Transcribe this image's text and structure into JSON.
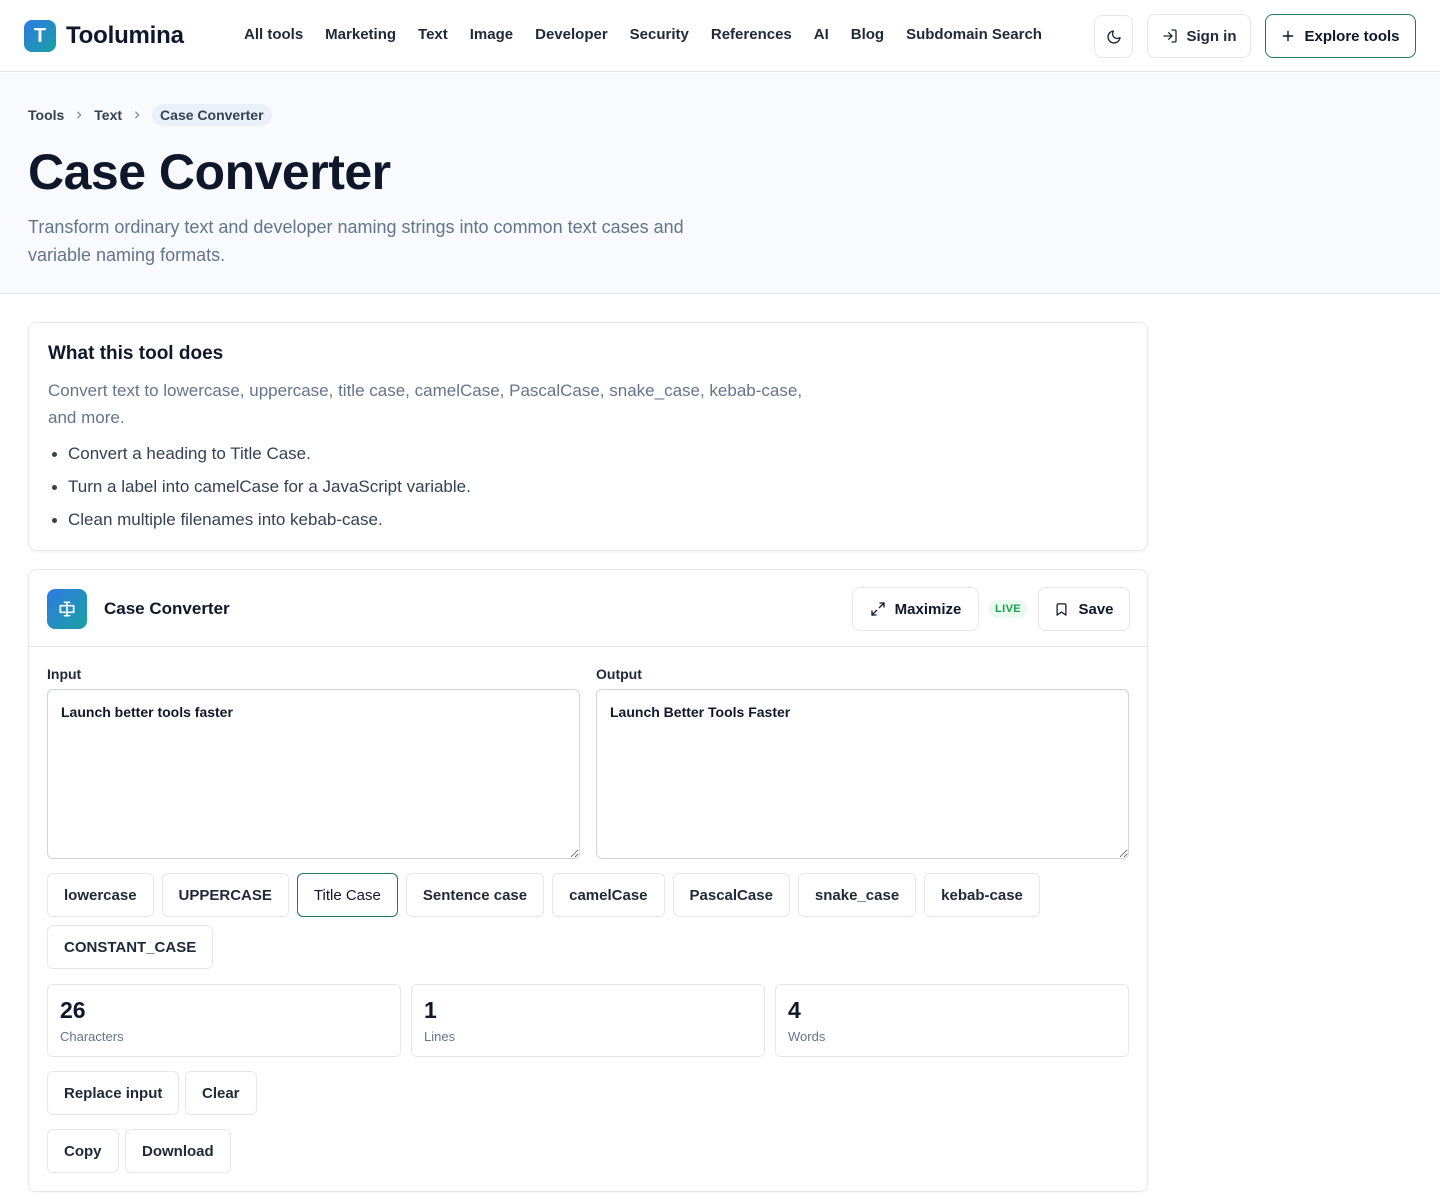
{
  "brand": {
    "logo_letter": "T",
    "name": "Toolumina"
  },
  "nav": [
    "All tools",
    "Marketing",
    "Text",
    "Image",
    "Developer",
    "Security",
    "References",
    "AI",
    "Blog",
    "Subdomain Search"
  ],
  "header": {
    "signin_label": "Sign in",
    "explore_label": "Explore tools"
  },
  "breadcrumb": {
    "root": "Tools",
    "category": "Text",
    "current": "Case Converter"
  },
  "hero": {
    "title": "Case Converter",
    "subtitle": "Transform ordinary text and developer naming strings into common text cases and variable naming formats."
  },
  "info": {
    "title": "What this tool does",
    "description": "Convert text to lowercase, uppercase, title case, camelCase, PascalCase, snake_case, kebab-case, and more.",
    "examples": [
      "Convert a heading to Title Case.",
      "Turn a label into camelCase for a JavaScript variable.",
      "Clean multiple filenames into kebab-case."
    ]
  },
  "tool": {
    "name": "Case Converter",
    "maximize_label": "Maximize",
    "live_label": "LIVE",
    "save_label": "Save",
    "input_label": "Input",
    "output_label": "Output",
    "input_value": "Launch better tools faster",
    "output_value": "Launch Better Tools Faster",
    "cases": [
      "lowercase",
      "UPPERCASE",
      "Title Case",
      "Sentence case",
      "camelCase",
      "PascalCase",
      "snake_case",
      "kebab-case",
      "CONSTANT_CASE"
    ],
    "active_case": "Title Case",
    "stats": {
      "characters": {
        "value": "26",
        "label": "Characters"
      },
      "lines": {
        "value": "1",
        "label": "Lines"
      },
      "words": {
        "value": "4",
        "label": "Words"
      }
    },
    "actions": {
      "replace": "Replace input",
      "clear": "Clear",
      "copy": "Copy",
      "download": "Download"
    }
  },
  "colors": {
    "accent": "#1f7a55",
    "brand_start": "#2f7ae5",
    "brand_end": "#1aa0a0",
    "live": "#16a34a"
  }
}
